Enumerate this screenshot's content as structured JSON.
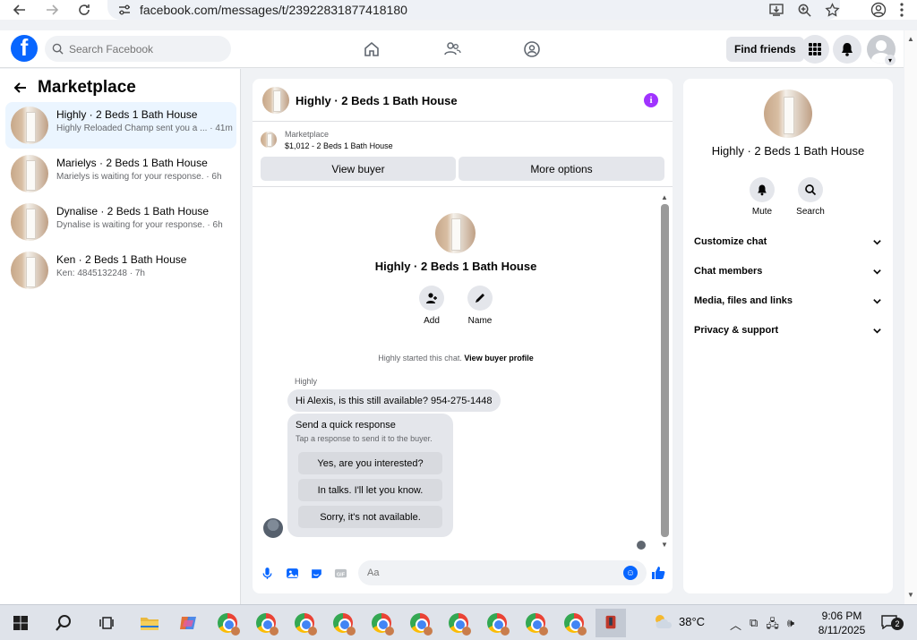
{
  "browser": {
    "url": "facebook.com/messages/t/23922831877418180"
  },
  "fb": {
    "search_placeholder": "Search Facebook",
    "find_friends": "Find friends",
    "logo_letter": "f"
  },
  "sidebar": {
    "title": "Marketplace",
    "conversations": [
      {
        "title": "Highly · 2 Beds 1 Bath House",
        "preview": "Highly Reloaded Champ sent you a ... · 41m"
      },
      {
        "title": "Marielys · 2 Beds 1 Bath House",
        "preview": "Marielys is waiting for your response. · 6h"
      },
      {
        "title": "Dynalise · 2 Beds 1 Bath House",
        "preview": "Dynalise is waiting for your response. · 6h"
      },
      {
        "title": "Ken · 2 Beds 1 Bath House",
        "preview": "Ken: 4845132248 · 7h"
      }
    ]
  },
  "chat": {
    "title": "Highly · 2 Beds 1 Bath House",
    "listing_label": "Marketplace",
    "listing_price": "$1,012 - 2 Beds 1 Bath House",
    "view_buyer": "View buyer",
    "more_options": "More options",
    "center_title": "Highly · 2 Beds 1 Bath House",
    "add_label": "Add",
    "name_label": "Name",
    "system_message": "Highly started this chat.",
    "view_buyer_profile": "View buyer profile",
    "sender_name": "Highly",
    "message": "Hi Alexis, is this still available? 954-275-1448",
    "quick_title": "Send a quick response",
    "quick_subtitle": "Tap a response to send it to the buyer.",
    "quick_responses": [
      "Yes, are you interested?",
      "In talks. I'll let you know.",
      "Sorry, it's not available."
    ],
    "composer_placeholder": "Aa"
  },
  "right_panel": {
    "title": "Highly · 2 Beds 1 Bath House",
    "mute": "Mute",
    "search": "Search",
    "sections": [
      "Customize chat",
      "Chat members",
      "Media, files and links",
      "Privacy & support"
    ]
  },
  "taskbar": {
    "temperature": "38°C",
    "time": "9:06 PM",
    "date": "8/11/2025",
    "notifications": "2"
  }
}
